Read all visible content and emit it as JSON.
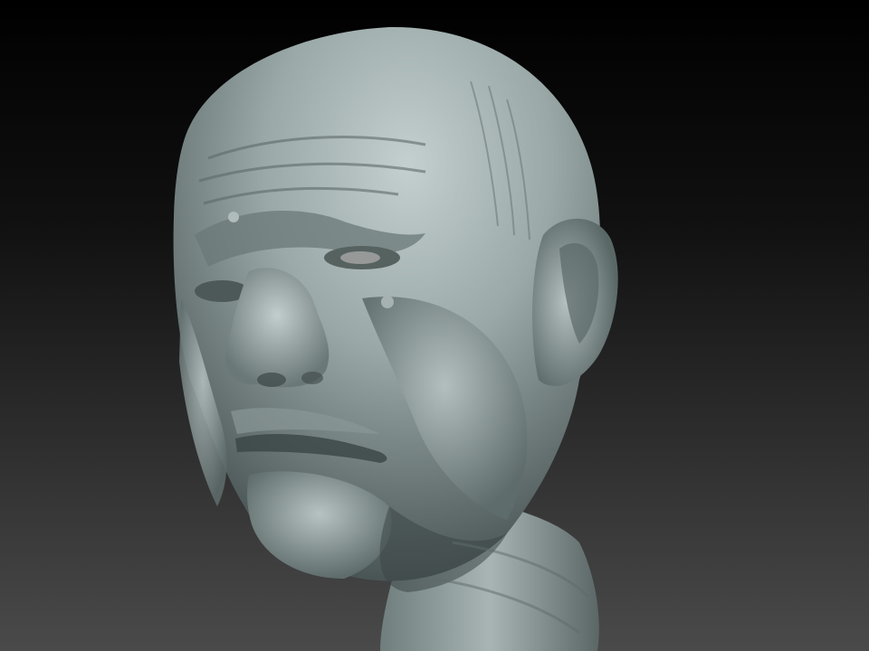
{
  "scene": {
    "subject": "sculpted-head",
    "colors": {
      "background_top": "#000000",
      "background_bottom": "#4a4a4a",
      "clay_highlight": "#c9d4d4",
      "clay_mid": "#8e9c9c",
      "clay_shadow": "#3c4646",
      "clay_deep": "#222a2a"
    }
  }
}
